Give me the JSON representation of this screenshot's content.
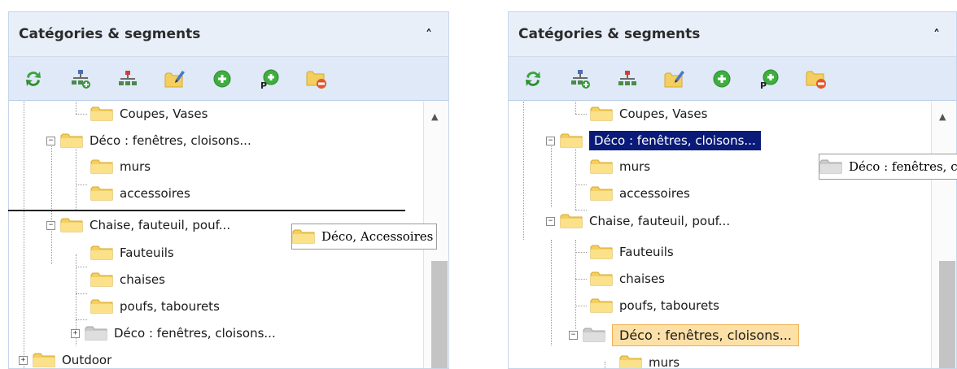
{
  "panel_title": "Catégories & segments",
  "left": {
    "tree": {
      "coupes": "Coupes, Vases",
      "deco": "Déco : fenêtres, cloisons...",
      "murs": "murs",
      "accessoires": "accessoires",
      "chaise": "Chaise, fauteuil, pouf...",
      "fauteuils": "Fauteuils",
      "chaises": "chaises",
      "poufs": "poufs, tabourets",
      "deco_copy": "Déco : fenêtres, cloisons...",
      "outdoor": "Outdoor"
    },
    "drag_label": "Déco, Accessoires"
  },
  "right": {
    "tree": {
      "coupes": "Coupes, Vases",
      "deco": "Déco : fenêtres, cloisons...",
      "murs": "murs",
      "accessoires": "accessoires",
      "chaise": "Chaise, fauteuil, pouf...",
      "fauteuils": "Fauteuils",
      "chaises": "chaises",
      "poufs": "poufs, tabourets",
      "deco_copy": "Déco : fenêtres, cloisons...",
      "murs_copy": "murs"
    },
    "drag_label": "Déco : fenêtres, cloisons..."
  },
  "expand_plus": "+",
  "expand_minus": "−",
  "colors": {
    "header_bg": "#e9eff8",
    "toolbar_bg": "#dfe9f7",
    "selected_bg": "#0a1a78",
    "highlight_bg": "#fde0a6"
  }
}
